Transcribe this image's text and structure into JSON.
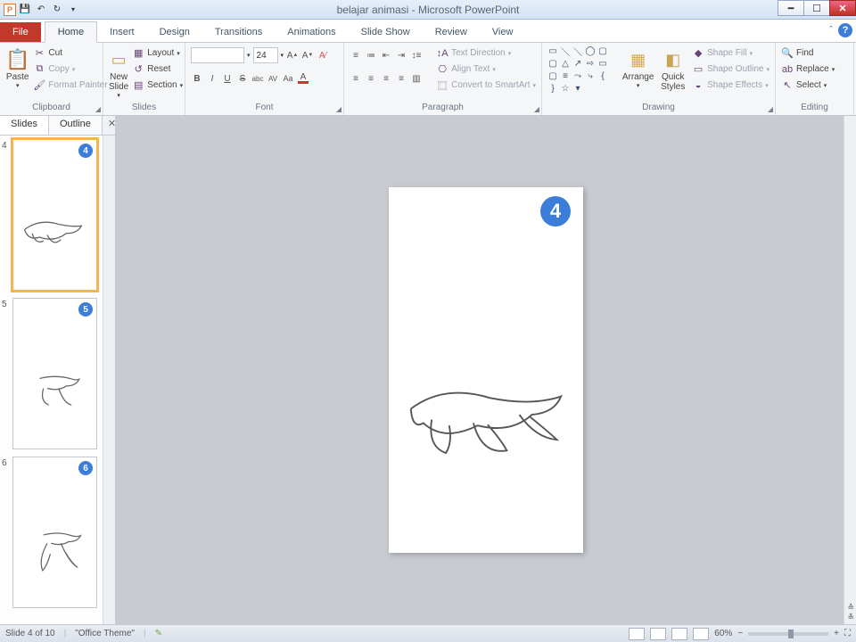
{
  "title": "belajar animasi - Microsoft PowerPoint",
  "qat": {
    "undo_tip": "↶",
    "redo_tip": "↻"
  },
  "tabs": {
    "file": "File",
    "home": "Home",
    "insert": "Insert",
    "design": "Design",
    "transitions": "Transitions",
    "animations": "Animations",
    "slideshow": "Slide Show",
    "review": "Review",
    "view": "View"
  },
  "groups": {
    "clipboard": {
      "label": "Clipboard",
      "paste": "Paste",
      "cut": "Cut",
      "copy": "Copy",
      "format_painter": "Format Painter"
    },
    "slides": {
      "label": "Slides",
      "new_slide": "New\nSlide",
      "layout": "Layout",
      "reset": "Reset",
      "section": "Section"
    },
    "font": {
      "label": "Font",
      "size": "24"
    },
    "paragraph": {
      "label": "Paragraph",
      "text_direction": "Text Direction",
      "align_text": "Align Text",
      "convert_smartart": "Convert to SmartArt"
    },
    "drawing": {
      "label": "Drawing",
      "arrange": "Arrange",
      "quick_styles": "Quick\nStyles",
      "shape_fill": "Shape Fill",
      "shape_outline": "Shape Outline",
      "shape_effects": "Shape Effects"
    },
    "editing": {
      "label": "Editing",
      "find": "Find",
      "replace": "Replace",
      "select": "Select"
    }
  },
  "panel": {
    "slides_tab": "Slides",
    "outline_tab": "Outline"
  },
  "thumbnails": [
    {
      "num": "4",
      "badge": "4",
      "selected": true
    },
    {
      "num": "5",
      "badge": "5",
      "selected": false
    },
    {
      "num": "6",
      "badge": "6",
      "selected": false
    }
  ],
  "canvas": {
    "badge": "4"
  },
  "status": {
    "slide_info": "Slide 4 of 10",
    "theme": "\"Office Theme\"",
    "zoom": "60%"
  }
}
